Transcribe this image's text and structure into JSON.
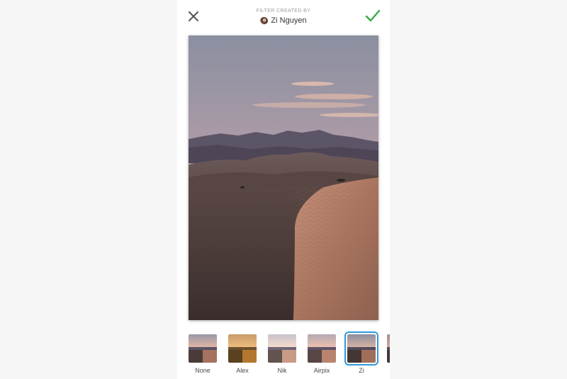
{
  "header": {
    "caption": "FILTER CREATED BY",
    "creator_name": "Zi Nguyen",
    "close_icon": "close-icon",
    "confirm_icon": "checkmark-icon"
  },
  "colors": {
    "confirm": "#3aa84a",
    "selected_outline": "#2d9ad8",
    "close": "#555555"
  },
  "filters": [
    {
      "label": "None",
      "selected": false
    },
    {
      "label": "Alex",
      "selected": false
    },
    {
      "label": "Nik",
      "selected": false
    },
    {
      "label": "Airpix",
      "selected": false
    },
    {
      "label": "Zi",
      "selected": true
    }
  ]
}
